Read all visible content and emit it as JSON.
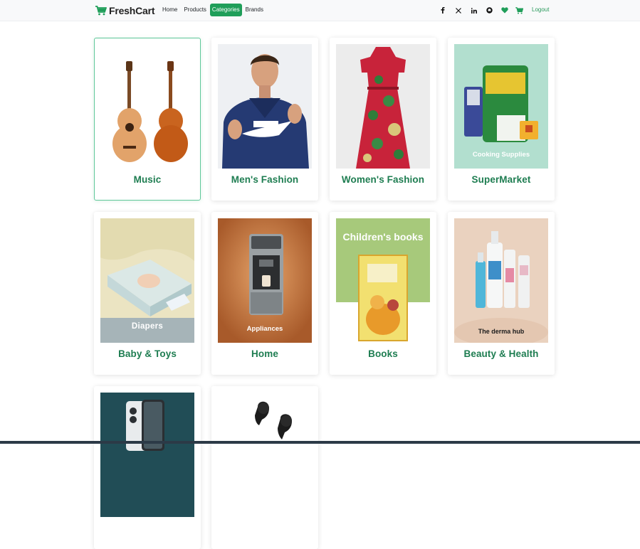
{
  "brand": {
    "name": "FreshCart"
  },
  "nav": {
    "links": [
      "Home",
      "Products",
      "Categories",
      "Brands"
    ],
    "active": "Categories",
    "social_icons": [
      "facebook-icon",
      "x-icon",
      "linkedin-icon",
      "github-icon",
      "heart-icon",
      "cart-icon"
    ],
    "logout_label": "Logout"
  },
  "colors": {
    "accent": "#1f9e59",
    "label": "#1e7d51",
    "navbar": "#f8f9fa"
  },
  "categories": [
    {
      "name": "Music",
      "image": "guitars"
    },
    {
      "name": "Men's Fashion",
      "image": "nike-hoodie-man"
    },
    {
      "name": "Women's Fashion",
      "image": "floral-dress"
    },
    {
      "name": "SuperMarket",
      "image": "cooking-supplies",
      "caption": "Cooking Supplies"
    },
    {
      "name": "Baby & Toys",
      "image": "diapers",
      "caption": "Diapers"
    },
    {
      "name": "Home",
      "image": "coffee-machine",
      "caption": "Appliances"
    },
    {
      "name": "Books",
      "image": "childrens-book",
      "caption": "Children's books"
    },
    {
      "name": "Beauty & Health",
      "image": "skincare-bottles",
      "caption": "The derma hub"
    },
    {
      "name": "",
      "image": "smartphone"
    },
    {
      "name": "",
      "image": "earbuds"
    }
  ]
}
